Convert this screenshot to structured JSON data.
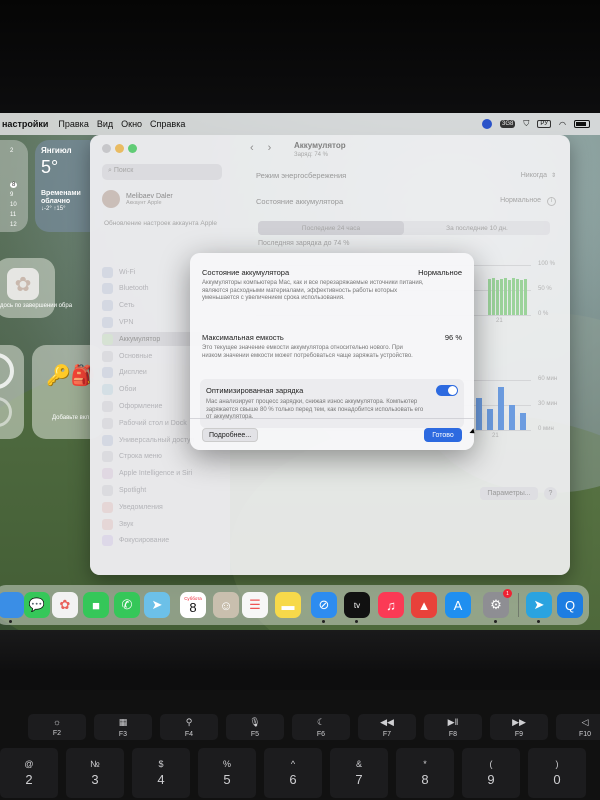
{
  "menubar": {
    "items": [
      "настройки",
      "Правка",
      "Вид",
      "Окно",
      "Справка"
    ],
    "right": {
      "badge": "3G8",
      "lang": "РУ"
    }
  },
  "widgets": {
    "calendar_days": [
      "2",
      "8",
      "9",
      "10",
      "11",
      "12"
    ],
    "weather": {
      "city": "Янгиюл",
      "temp": "5°",
      "desc": "Временами облачно",
      "range": "↓-2° ↑15°"
    },
    "photos_label": "дось по завершении обра",
    "toys_label": "Добавьте вкл"
  },
  "settings": {
    "search_placeholder": "Поиск",
    "user_name": "Melibaev Daler",
    "user_sub": "Аккаунт Apple",
    "suggest": "Обновление настроек аккаунта Apple",
    "sidebar": [
      {
        "label": "Wi-Fi",
        "color": "#c6cbd9"
      },
      {
        "label": "Bluetooth",
        "color": "#c6cbd9"
      },
      {
        "label": "Сеть",
        "color": "#c6cbd9"
      },
      {
        "label": "VPN",
        "color": "#c6cbd9"
      },
      {
        "label": "Аккумулятор",
        "color": "#c8d8c4",
        "active": true
      },
      {
        "label": "Основные",
        "color": "#cfcfd4"
      },
      {
        "label": "Дисплеи",
        "color": "#c6cbd9"
      },
      {
        "label": "Обои",
        "color": "#c6d4dc"
      },
      {
        "label": "Оформление",
        "color": "#cfcfd4"
      },
      {
        "label": "Рабочий стол и Dock",
        "color": "#cfcfd4"
      },
      {
        "label": "Универсальный доступ",
        "color": "#c6cbd9"
      },
      {
        "label": "Строка меню",
        "color": "#cfcfd4"
      },
      {
        "label": "Apple Intelligence и Siri",
        "color": "#d6cbd9"
      },
      {
        "label": "Spotlight",
        "color": "#cfcfd4"
      },
      {
        "label": "Уведомления",
        "color": "#ddc9c9"
      },
      {
        "label": "Звук",
        "color": "#ddc9c9"
      },
      {
        "label": "Фокусирование",
        "color": "#d2cbe0"
      }
    ],
    "title": "Аккумулятор",
    "subtitle": "Заряд: 74 %",
    "power_mode_label": "Режим энергосбережения",
    "power_mode_value": "Никогда",
    "battery_state_label": "Состояние аккумулятора",
    "battery_state_value": "Нормальное",
    "tabs": [
      "Последние 24 часа",
      "За последние 10 дн."
    ],
    "last_charge": "Последняя зарядка до 74 %",
    "params_button": "Параметры...",
    "help": "?"
  },
  "chart_data": [
    {
      "type": "bar",
      "ylim": [
        0,
        100
      ],
      "ytick_labels": [
        "100 %",
        "50 %",
        "0 %"
      ],
      "xtick_labels": [
        "21"
      ],
      "values": [
        72,
        74,
        70,
        73,
        75,
        71,
        74,
        72,
        70,
        73
      ]
    },
    {
      "type": "bar",
      "ylim": [
        0,
        60
      ],
      "ytick_labels": [
        "60 мин",
        "30 мин",
        "0 мин"
      ],
      "xtick_labels": [
        "21"
      ],
      "values": [
        38,
        25,
        52,
        30,
        20
      ]
    }
  ],
  "sheet": {
    "sections": [
      {
        "title": "Состояние аккумулятора",
        "value": "Нормальное",
        "desc": "Аккумуляторы компьютера Mac, как и все перезаряжаемые источники питания, являются расходными материалами, эффективность работы которых уменьшается с увеличением срока использования."
      },
      {
        "title": "Максимальная емкость",
        "value": "96 %",
        "desc": "Это текущее значение емкости аккумулятора относительно нового. При низком значении емкости может потребоваться чаще заряжать устройство."
      },
      {
        "title": "Оптимизированная зарядка",
        "value": "",
        "desc": "Mac анализирует процесс зарядки, снижая износ аккумулятора. Компьютер заряжается свыше 80 % только перед тем, как понадобится использовать его от аккумулятора.",
        "toggle": true
      }
    ],
    "more_button": "Подробнее...",
    "done_button": "Готово"
  },
  "dock": {
    "apps": [
      {
        "name": "finder",
        "glyph": "",
        "color": "#3a8ee6"
      },
      {
        "name": "messages",
        "glyph": "💬",
        "color": "#35c759"
      },
      {
        "name": "photos",
        "glyph": "✿",
        "color": "#f2f2f2"
      },
      {
        "name": "facetime",
        "glyph": "■",
        "color": "#35c759"
      },
      {
        "name": "phone",
        "glyph": "✆",
        "color": "#35c759"
      },
      {
        "name": "maps",
        "glyph": "➤",
        "color": "#6cc0e8"
      },
      {
        "name": "calendar",
        "glyph": "",
        "color": "#ffffff"
      },
      {
        "name": "contacts",
        "glyph": "☺",
        "color": "#c9bfae"
      },
      {
        "name": "reminders",
        "glyph": "☰",
        "color": "#f7f7f7"
      },
      {
        "name": "notes",
        "glyph": "▬",
        "color": "#f7d94a"
      },
      {
        "name": "safari",
        "glyph": "⊘",
        "color": "#2d8cf0"
      },
      {
        "name": "apple-tv",
        "glyph": "tv",
        "color": "#111111"
      },
      {
        "name": "music",
        "glyph": "♫",
        "color": "#fb3a55"
      },
      {
        "name": "rocket",
        "glyph": "▲",
        "color": "#e8413a"
      },
      {
        "name": "app-store",
        "glyph": "A",
        "color": "#1f8ff0"
      },
      {
        "name": "system-settings",
        "glyph": "⚙",
        "color": "#8e8e93"
      },
      {
        "name": "telegram",
        "glyph": "➤",
        "color": "#2aa3e0"
      },
      {
        "name": "quicktime",
        "glyph": "Q",
        "color": "#1d7de2"
      }
    ],
    "calendar_month": "Суббота",
    "calendar_day": "8",
    "settings_badge": "1"
  },
  "keyboard": {
    "fkeys": [
      "F2",
      "F3",
      "F4",
      "F5",
      "F6",
      "F7",
      "F8",
      "F9",
      "F10"
    ],
    "fkey_icons": [
      "☼",
      "▦",
      "⚲",
      "🎙",
      "☾",
      "◀◀",
      "▶‖",
      "▶▶",
      "◁"
    ],
    "num_keys": [
      {
        "top": "@",
        "main": "2"
      },
      {
        "top": "№",
        "main": "3"
      },
      {
        "top": "$",
        "main": "4"
      },
      {
        "top": "%",
        "main": "5"
      },
      {
        "top": "^",
        "main": "6"
      },
      {
        "top": "&",
        "main": "7"
      },
      {
        "top": "*",
        "main": "8"
      },
      {
        "top": "(",
        "main": "9"
      },
      {
        "top": ")",
        "main": "0"
      }
    ]
  }
}
